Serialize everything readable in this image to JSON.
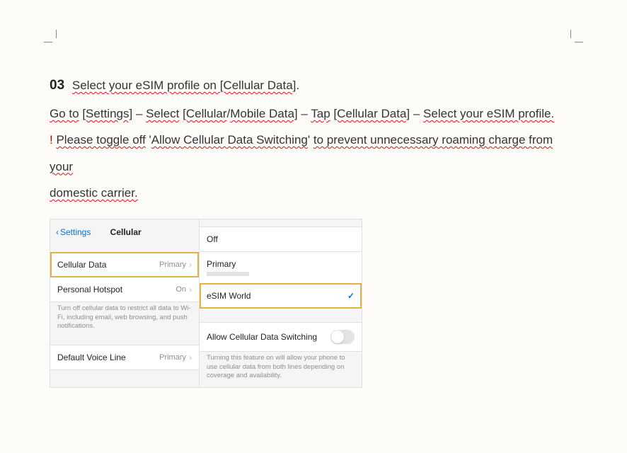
{
  "step": {
    "number": "03",
    "title_1": "Select your eSIM profile on [Cellular Data]",
    "title_end": ".",
    "path_go_to": "Go to",
    "path_settings": "[Settings]",
    "dash": " – ",
    "path_select": "Select",
    "path_cellular": "[Cellular",
    "slash": "/",
    "path_mobile": "Mobile Data]",
    "path_tap": "Tap",
    "path_cell_data": "[Cellular Data]",
    "path_select_esim": "Select your eSIM profile.",
    "warn_bar": "!",
    "warn_please": "Please toggle off",
    "warn_q1": " '",
    "warn_allow": "Allow Cellular Data Switching",
    "warn_q2": "' ",
    "warn_rest": "to prevent unnecessary roaming charge from your",
    "warn_rest2": "domestic carrier."
  },
  "left": {
    "back": "Settings",
    "title": "Cellular",
    "cellular_data": "Cellular Data",
    "cellular_data_val": "Primary",
    "hotspot": "Personal Hotspot",
    "hotspot_val": "On",
    "foot1": "Turn off cellular data to restrict all data to Wi-Fi, including email, web browsing, and push notifications.",
    "voice": "Default Voice Line",
    "voice_val": "Primary"
  },
  "right": {
    "off": "Off",
    "primary": "Primary",
    "esim": "eSIM World",
    "allow": "Allow Cellular Data Switching",
    "foot2": "Turning this feature on will allow your phone to use cellular data from both lines depending on coverage and availability."
  }
}
